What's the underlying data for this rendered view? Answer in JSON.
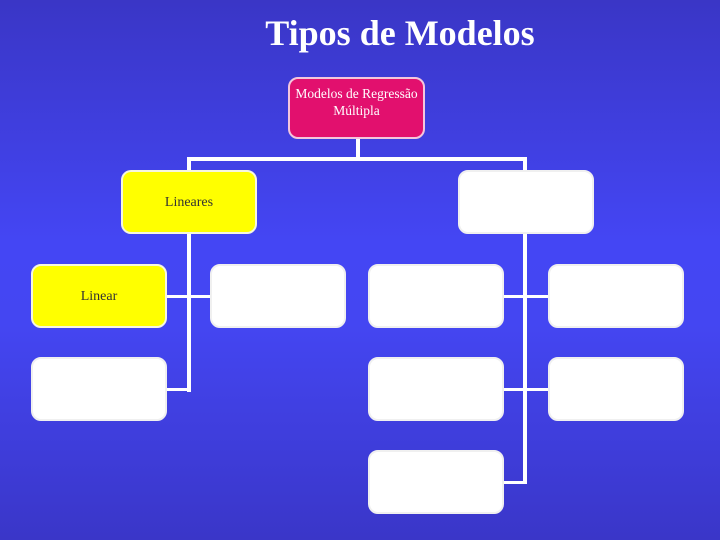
{
  "slide": {
    "title": "Tipos de Modelos",
    "background_color": "#4446f4",
    "accent_colors": {
      "root": "#e2106e",
      "highlight": "#ffff00",
      "empty": "#ffffff"
    }
  },
  "diagram": {
    "root": {
      "label_line1": "Modelos de Regressão",
      "label_line2": "Múltipla"
    },
    "level1": [
      {
        "label": "Lineares"
      },
      {
        "label": ""
      }
    ],
    "level2_left": [
      {
        "label": "Linear"
      },
      {
        "label": ""
      },
      {
        "label": ""
      }
    ],
    "level2_right": [
      {
        "label": ""
      },
      {
        "label": ""
      },
      {
        "label": ""
      },
      {
        "label": ""
      },
      {
        "label": ""
      }
    ]
  }
}
